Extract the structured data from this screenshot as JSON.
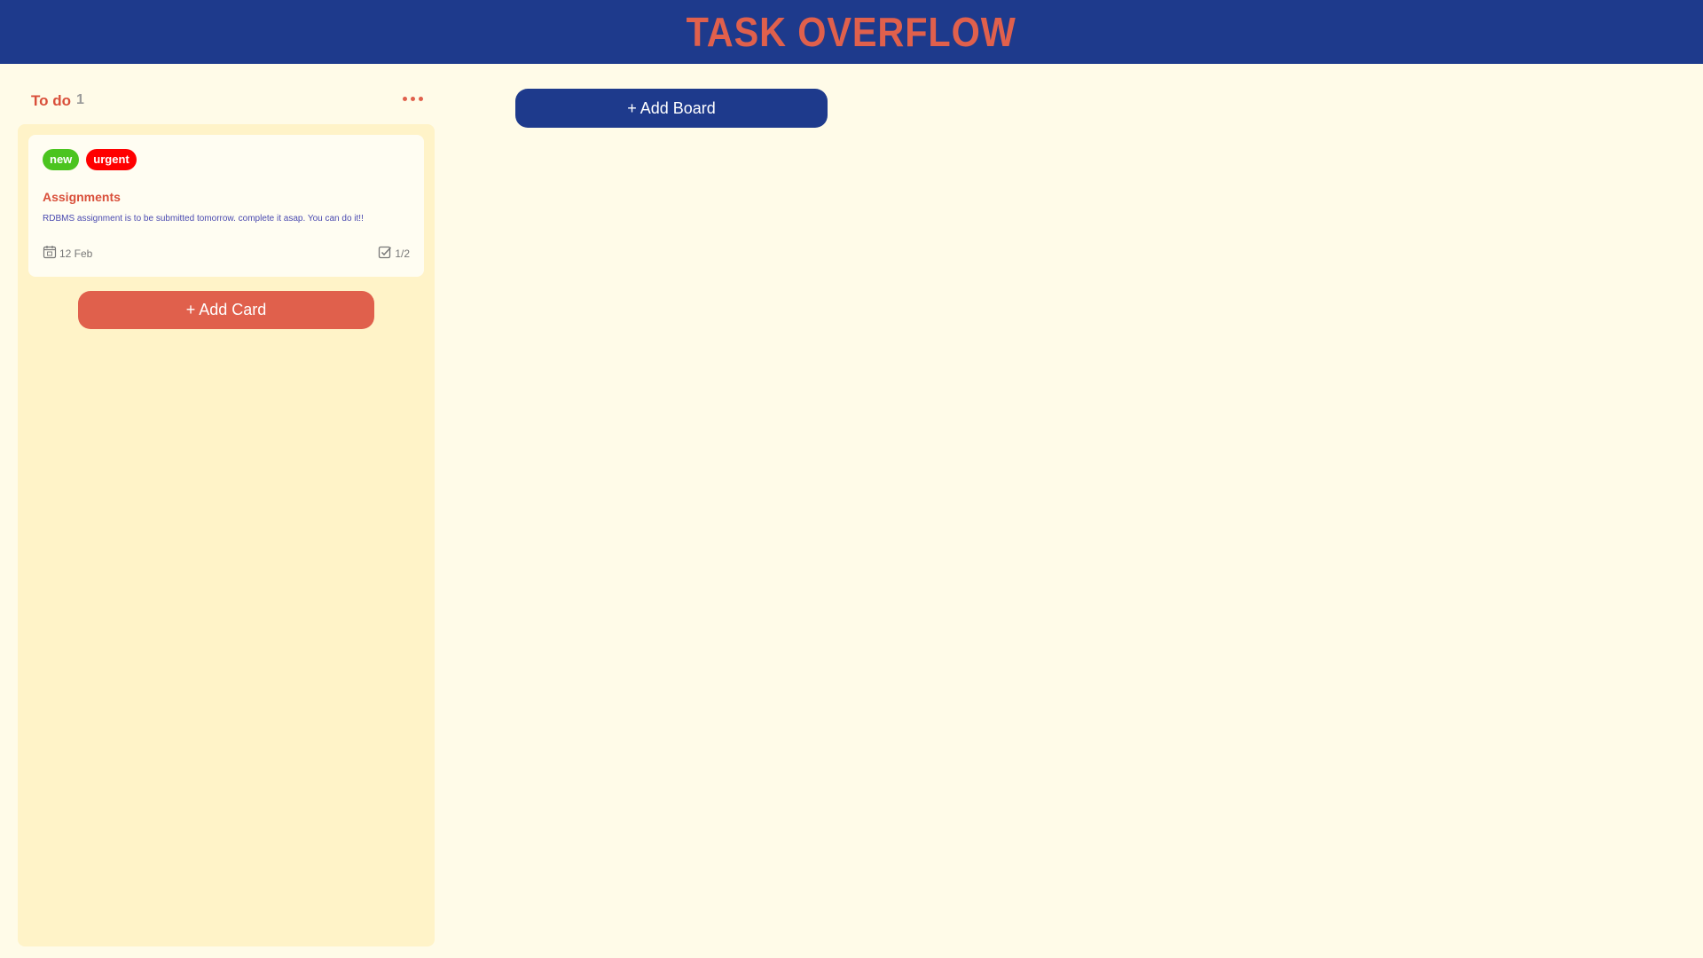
{
  "app": {
    "title": "TASK OVERFLOW"
  },
  "board": {
    "title": "To do",
    "count": "1",
    "cards": [
      {
        "labels": [
          {
            "text": "new",
            "color": "#4bc41f"
          },
          {
            "text": "urgent",
            "color": "#ff0000"
          }
        ],
        "title": "Assignments",
        "description": "RDBMS assignment is to be submitted tomorrow. complete it asap. You can do it!!",
        "date": "12 Feb",
        "tasks": "1/2"
      }
    ],
    "add_card_label": "+ Add Card"
  },
  "add_board_label": "+ Add Board",
  "colors": {
    "header": "#1e3a8c",
    "accent": "#e0604c",
    "background": "#fffbe8",
    "board": "#fff3c8"
  }
}
